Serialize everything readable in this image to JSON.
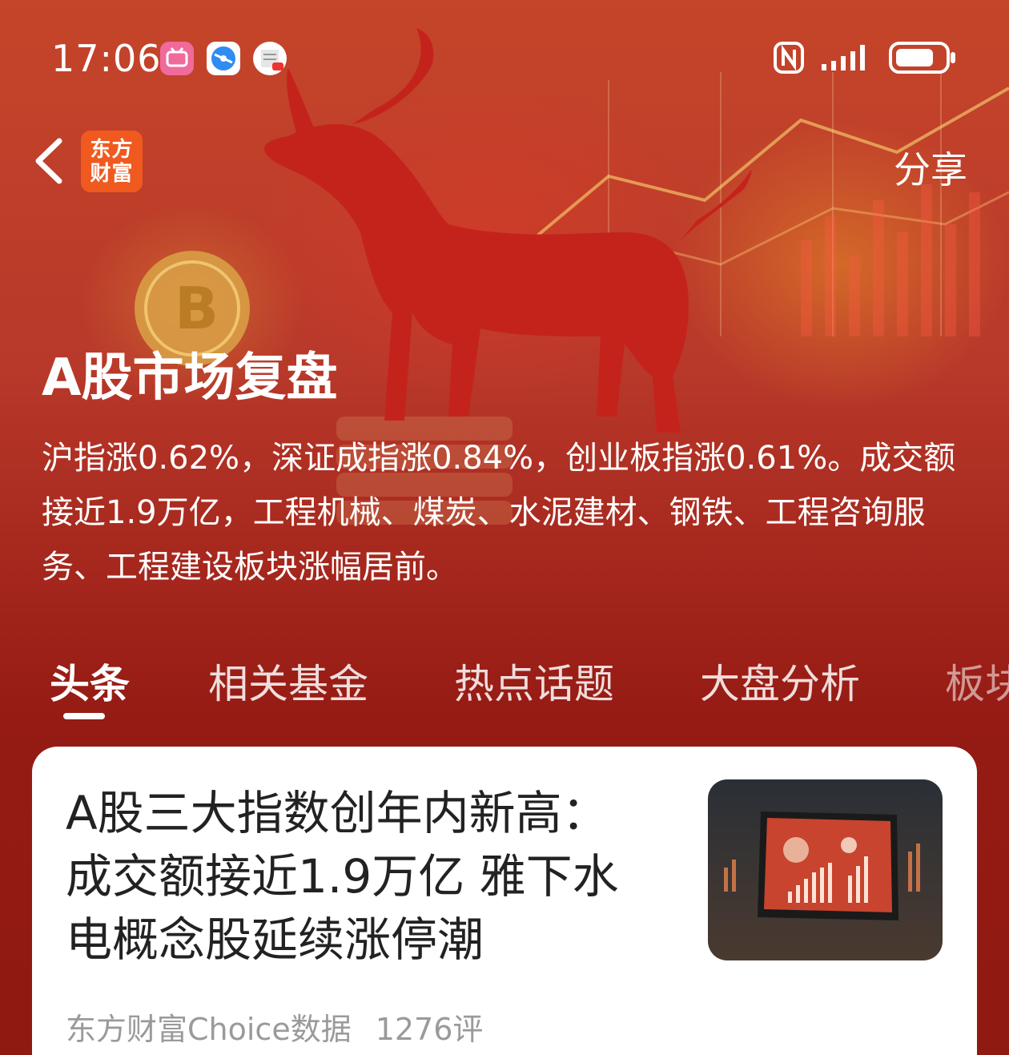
{
  "status_bar": {
    "time": "17:06",
    "app_icons": [
      "bilibili-icon",
      "browser-icon",
      "document-app-icon"
    ],
    "right_icons": [
      "nfc-icon",
      "signal-icon",
      "battery-icon"
    ]
  },
  "header": {
    "logo_line1": "东方",
    "logo_line2": "财富",
    "share": "分享"
  },
  "banner": {
    "title": "A股市场复盘",
    "summary": "沪指涨0.62%，深证成指涨0.84%，创业板指涨0.61%。成交额接近1.9万亿，工程机械、煤炭、水泥建材、钢铁、工程咨询服务、工程建设板块涨幅居前。"
  },
  "tabs": [
    {
      "label": "头条",
      "active": true
    },
    {
      "label": "相关基金",
      "active": false
    },
    {
      "label": "热点话题",
      "active": false
    },
    {
      "label": "大盘分析",
      "active": false
    },
    {
      "label": "板块",
      "active": false
    }
  ],
  "article": {
    "title": "A股三大指数创年内新高：成交额接近1.9万亿 雅下水电概念股延续涨停潮",
    "source": "东方财富Choice数据",
    "comments": "1276评"
  },
  "colors": {
    "background_red": "#8f1a12",
    "logo_orange": "#f05a1f",
    "card_white": "#ffffff",
    "meta_gray": "#9a9a9a"
  }
}
